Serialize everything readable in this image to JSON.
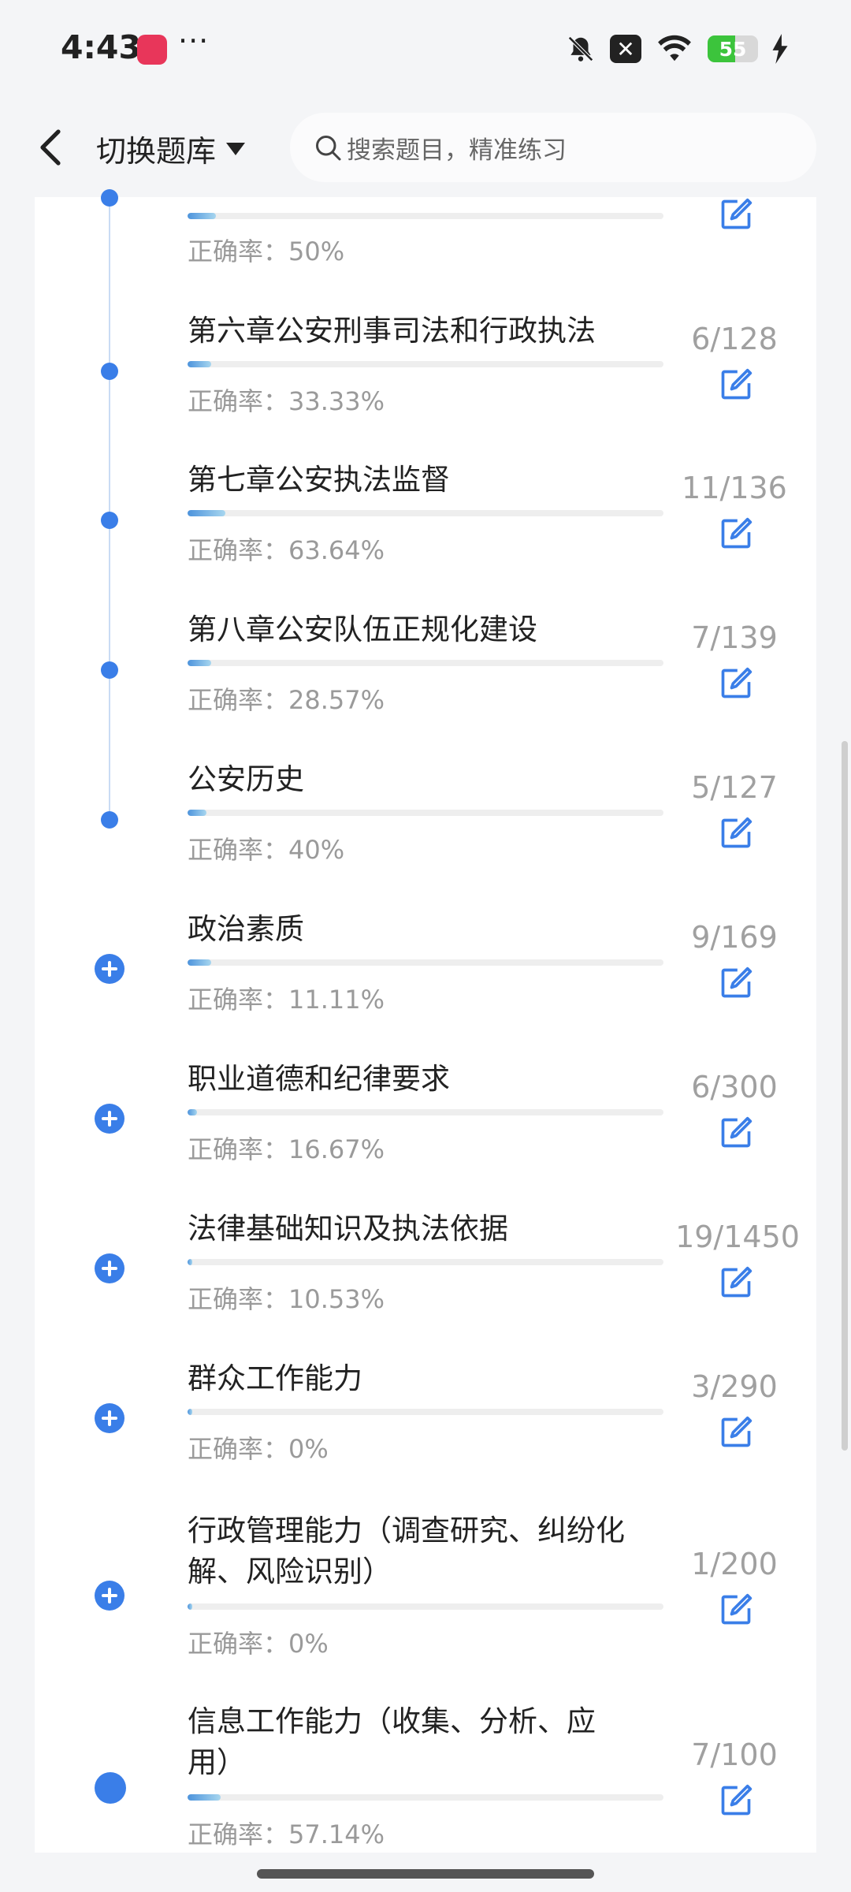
{
  "status": {
    "time": "4:43",
    "dots": "···",
    "battery": "55"
  },
  "header": {
    "switch_label": "切换题库",
    "search_placeholder": "搜索题目，精准练习"
  },
  "items": [
    {
      "title": "",
      "accuracy": "正确率：50%",
      "count": "",
      "progress": 0.06
    },
    {
      "title": "第六章公安刑事司法和行政执法",
      "accuracy": "正确率：33.33%",
      "count": "6/128",
      "progress": 0.05
    },
    {
      "title": "第七章公安执法监督",
      "accuracy": "正确率：63.64%",
      "count": "11/136",
      "progress": 0.08
    },
    {
      "title": "第八章公安队伍正规化建设",
      "accuracy": "正确率：28.57%",
      "count": "7/139",
      "progress": 0.05
    },
    {
      "title": "公安历史",
      "accuracy": "正确率：40%",
      "count": "5/127",
      "progress": 0.04
    },
    {
      "title": "政治素质",
      "accuracy": "正确率：11.11%",
      "count": "9/169",
      "progress": 0.05
    },
    {
      "title": "职业道德和纪律要求",
      "accuracy": "正确率：16.67%",
      "count": "6/300",
      "progress": 0.02
    },
    {
      "title": "法律基础知识及执法依据",
      "accuracy": "正确率：10.53%",
      "count": "19/1450",
      "progress": 0.01
    },
    {
      "title": "群众工作能力",
      "accuracy": "正确率：0%",
      "count": "3/290",
      "progress": 0.01
    },
    {
      "title": "行政管理能力（调查研究、纠纷化解、风险识别）",
      "accuracy": "正确率：0%",
      "count": "1/200",
      "progress": 0.01
    },
    {
      "title": "信息工作能力（收集、分析、应用）",
      "accuracy": "正确率：57.14%",
      "count": "7/100",
      "progress": 0.07
    }
  ]
}
